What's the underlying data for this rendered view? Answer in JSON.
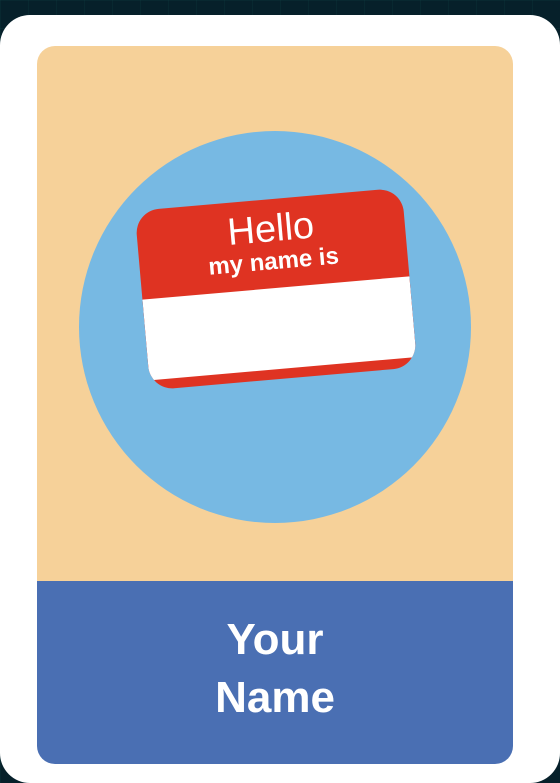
{
  "card": {
    "tag_hello": "Hello",
    "tag_subtitle": "my name is",
    "name_line1": "Your",
    "name_line2": "Name"
  },
  "colors": {
    "page_background": "#06202a",
    "card_background": "#ffffff",
    "art_background": "#f6d199",
    "circle": "#77b9e3",
    "tag_red": "#df3322",
    "name_panel": "#4a6fb3",
    "text_white": "#ffffff"
  }
}
